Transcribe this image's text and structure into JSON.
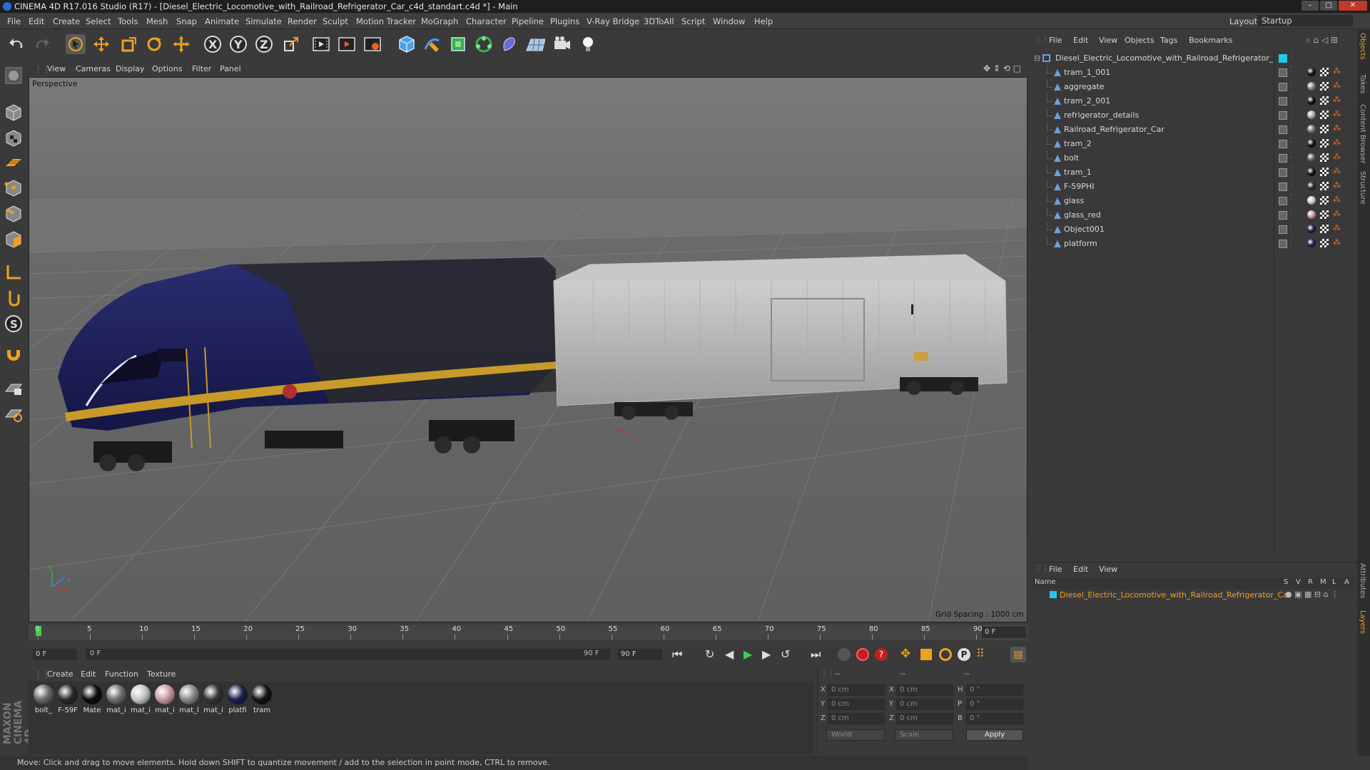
{
  "window": {
    "title": "CINEMA 4D R17.016 Studio (R17) - [Diesel_Electric_Locomotive_with_Railroad_Refrigerator_Car_c4d_standart.c4d *] - Main",
    "layout_label": "Layout:",
    "layout_value": "Startup"
  },
  "menu": [
    "File",
    "Edit",
    "Create",
    "Select",
    "Tools",
    "Mesh",
    "Snap",
    "Animate",
    "Simulate",
    "Render",
    "Sculpt",
    "Motion Tracker",
    "MoGraph",
    "Character",
    "Pipeline",
    "Plugins",
    "V-Ray Bridge",
    "3DToAll",
    "Script",
    "Window",
    "Help"
  ],
  "toolbar_icons": [
    "undo-icon",
    "redo-icon",
    "select-arrow-icon",
    "move-icon",
    "scale-icon",
    "rotate-icon",
    "live-select-icon",
    "x-axis-icon",
    "y-axis-icon",
    "z-axis-icon",
    "coordinate-system-icon",
    "render-view-icon",
    "render-picture-viewer-icon",
    "render-settings-icon",
    "cube-icon",
    "pen-spline-icon",
    "subdivision-icon",
    "mograph-cloner-icon",
    "deformer-icon",
    "floor-icon",
    "camera-icon",
    "light-icon"
  ],
  "viewport": {
    "menu": [
      "View",
      "Cameras",
      "Display",
      "Options",
      "Filter",
      "Panel"
    ],
    "label": "Perspective",
    "grid_spacing": "Grid Spacing : 1000 cm",
    "axis_y": "y",
    "axis_z": "z"
  },
  "timeline": {
    "ticks": [
      "0",
      "5",
      "10",
      "15",
      "20",
      "25",
      "30",
      "35",
      "40",
      "45",
      "50",
      "55",
      "60",
      "65",
      "70",
      "75",
      "80",
      "85",
      "90"
    ],
    "current_frame_right": "0 F",
    "start_frame": "0 F",
    "range_start": "0 F",
    "range_end": "90 F",
    "end_frame": "90 F"
  },
  "materials": {
    "menu": [
      "Create",
      "Edit",
      "Function",
      "Texture"
    ],
    "items": [
      {
        "label": "bolt_",
        "color": "#6a6a6a"
      },
      {
        "label": "F-59F",
        "color": "#2a2a2a"
      },
      {
        "label": "Mate",
        "color": "#0d0d0d"
      },
      {
        "label": "mat_i",
        "color": "#6e6e6e"
      },
      {
        "label": "mat_i",
        "color": "#c4c4c4"
      },
      {
        "label": "mat_i",
        "color": "#c89aa0"
      },
      {
        "label": "mat_l",
        "color": "#8a8a8a"
      },
      {
        "label": "mat_i",
        "color": "#353535"
      },
      {
        "label": "platfi",
        "color": "#1c1f4a"
      },
      {
        "label": "tram",
        "color": "#151515"
      }
    ]
  },
  "coords": {
    "header": [
      "--",
      "--",
      "--"
    ],
    "rows": [
      {
        "a": "X",
        "av": "0 cm",
        "b": "X",
        "bv": "0 cm",
        "c": "H",
        "cv": "0 °"
      },
      {
        "a": "Y",
        "av": "0 cm",
        "b": "Y",
        "bv": "0 cm",
        "c": "P",
        "cv": "0 °"
      },
      {
        "a": "Z",
        "av": "0 cm",
        "b": "Z",
        "bv": "0 cm",
        "c": "B",
        "cv": "0 °"
      }
    ],
    "space": "World",
    "mode": "Scale",
    "apply": "Apply"
  },
  "status": "Move: Click and drag to move elements. Hold down SHIFT to quantize movement / add to the selection in point mode, CTRL to remove.",
  "objects": {
    "menu": [
      "File",
      "Edit",
      "View",
      "Objects",
      "Tags",
      "Bookmarks"
    ],
    "root": "Diesel_Electric_Locomotive_with_Railroad_Refrigerator_Car",
    "items": [
      {
        "name": "tram_1_001",
        "mat": "#111111"
      },
      {
        "name": "aggregate",
        "mat": "#8a8a8a"
      },
      {
        "name": "tram_2_001",
        "mat": "#111111"
      },
      {
        "name": "refrigerator_details",
        "mat": "#aaaaaa"
      },
      {
        "name": "Railroad_Refrigerator_Car",
        "mat": "#777777"
      },
      {
        "name": "tram_2",
        "mat": "#111111"
      },
      {
        "name": "bolt",
        "mat": "#666666"
      },
      {
        "name": "tram_1",
        "mat": "#111111"
      },
      {
        "name": "F-59PHI",
        "mat": "#2a2a2a"
      },
      {
        "name": "glass",
        "mat": "#cccccc"
      },
      {
        "name": "glass_red",
        "mat": "#c89aa0"
      },
      {
        "name": "Object001",
        "mat": "#1c1f4a"
      },
      {
        "name": "platform",
        "mat": "#1c1f4a"
      }
    ]
  },
  "layers": {
    "menu": [
      "File",
      "Edit",
      "View"
    ],
    "columns": [
      "Name",
      "S",
      "V",
      "R",
      "M",
      "L",
      "A"
    ],
    "row": "Diesel_Electric_Locomotive_with_Railroad_Refrigerator_Car",
    "accent": "#22c8e8"
  },
  "side_tabs": [
    "Objects",
    "Takes",
    "Content Browser",
    "Structure",
    "Attributes",
    "Layers"
  ],
  "logo": "MAXON CINEMA 4D"
}
